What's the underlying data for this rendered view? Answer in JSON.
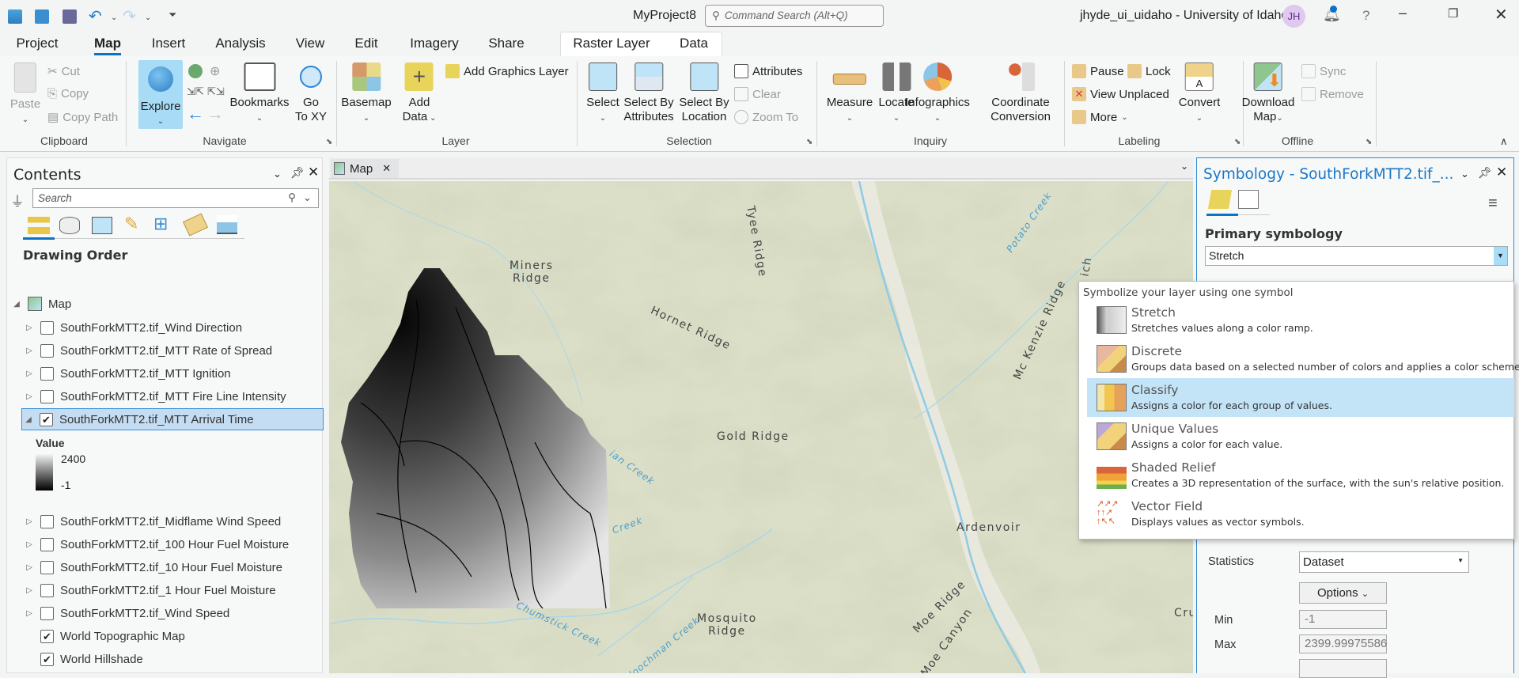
{
  "titlebar": {
    "project": "MyProject8",
    "search_placeholder": "Command Search (Alt+Q)",
    "user": "jhyde_ui_uidaho - University of Idaho",
    "avatar": "JH",
    "help": "?"
  },
  "tabs": [
    "Project",
    "Map",
    "Insert",
    "Analysis",
    "View",
    "Edit",
    "Imagery",
    "Share"
  ],
  "context_tabs": [
    "Raster Layer",
    "Data"
  ],
  "ribbon": {
    "clipboard": {
      "label": "Clipboard",
      "paste": "Paste",
      "cut": "Cut",
      "copy": "Copy",
      "copy_path": "Copy Path"
    },
    "navigate": {
      "label": "Navigate",
      "explore": "Explore",
      "bookmarks": "Bookmarks",
      "goto_1": "Go",
      "goto_2": "To XY"
    },
    "layer": {
      "label": "Layer",
      "basemap": "Basemap",
      "add_data_1": "Add",
      "add_data_2": "Data",
      "add_graphics": "Add Graphics Layer"
    },
    "selection": {
      "label": "Selection",
      "select": "Select",
      "by_attr_1": "Select By",
      "by_attr_2": "Attributes",
      "by_loc_1": "Select By",
      "by_loc_2": "Location",
      "attributes": "Attributes",
      "clear": "Clear",
      "zoom_to": "Zoom To"
    },
    "inquiry": {
      "label": "Inquiry",
      "measure": "Measure",
      "locate": "Locate",
      "infographics": "Infographics",
      "coord_1": "Coordinate",
      "coord_2": "Conversion"
    },
    "labeling": {
      "label": "Labeling",
      "pause": "Pause",
      "lock": "Lock",
      "view_unplaced": "View Unplaced",
      "more": "More",
      "convert": "Convert"
    },
    "offline": {
      "label": "Offline",
      "download_1": "Download",
      "download_2": "Map",
      "sync": "Sync",
      "remove": "Remove"
    }
  },
  "contents": {
    "title": "Contents",
    "search_placeholder": "Search",
    "section": "Drawing Order",
    "map": "Map",
    "layers": [
      {
        "name": "SouthForkMTT2.tif_Wind Direction",
        "checked": false
      },
      {
        "name": "SouthForkMTT2.tif_MTT Rate of Spread",
        "checked": false
      },
      {
        "name": "SouthForkMTT2.tif_MTT Ignition",
        "checked": false
      },
      {
        "name": "SouthForkMTT2.tif_MTT Fire Line Intensity",
        "checked": false
      },
      {
        "name": "SouthForkMTT2.tif_MTT Arrival Time",
        "checked": true,
        "selected": true
      },
      {
        "name": "SouthForkMTT2.tif_Midflame Wind Speed",
        "checked": false
      },
      {
        "name": "SouthForkMTT2.tif_100 Hour Fuel Moisture",
        "checked": false
      },
      {
        "name": "SouthForkMTT2.tif_10 Hour Fuel Moisture",
        "checked": false
      },
      {
        "name": "SouthForkMTT2.tif_1 Hour Fuel Moisture",
        "checked": false
      },
      {
        "name": "SouthForkMTT2.tif_Wind Speed",
        "checked": false
      },
      {
        "name": "World Topographic Map",
        "checked": true
      },
      {
        "name": "World Hillshade",
        "checked": true
      }
    ],
    "legend": {
      "title": "Value",
      "max": "2400",
      "min": "-1"
    }
  },
  "map": {
    "tab": "Map",
    "labels": {
      "miners_1": "Miners",
      "miners_2": "Ridge",
      "tyee": "Tyee Ridge",
      "hornet": "Hornet Ridge",
      "gold": "Gold Ridge",
      "ardenvoir": "Ardenvoir",
      "mosquito_1": "Mosquito",
      "mosquito_2": "Ridge",
      "moe_ridge": "Moe Ridge",
      "moe_canyon": "Moe Canyon",
      "chumstick": "Chumstick Creek",
      "potato": "Potato Creek",
      "mckenzie": "Mc Kenzie Ridge",
      "cru": "Cru",
      "ian_creek": "ian Creek",
      "creek": "Creek",
      "kloochman": "Kloochman Creek",
      "ich": "ich"
    }
  },
  "symbology": {
    "title": "Symbology - SouthForkMTT2.tif_...",
    "primary_label": "Primary symbology",
    "primary_value": "Stretch",
    "dropdown_header": "Symbolize your layer using one symbol",
    "options": [
      {
        "title": "Stretch",
        "desc": "Stretches values along a color ramp."
      },
      {
        "title": "Discrete",
        "desc": "Groups data based on a selected number of colors and applies a color scheme."
      },
      {
        "title": "Classify",
        "desc": "Assigns a color for each group of values.",
        "highlighted": true
      },
      {
        "title": "Unique Values",
        "desc": "Assigns a color for each value."
      },
      {
        "title": "Shaded Relief",
        "desc": "Creates a 3D representation of the surface, with the sun's relative position."
      },
      {
        "title": "Vector Field",
        "desc": "Displays values as vector symbols."
      }
    ],
    "statistics_label": "Statistics",
    "statistics_value": "Dataset",
    "options_button": "Options",
    "min_label": "Min",
    "min_value": "-1",
    "max_label": "Max",
    "max_value": "2399.99975586"
  },
  "colors": {
    "accent": "#0b72c6",
    "selection": "#c5ddf2",
    "dropdown_highlight": "#c3e3f7",
    "map_land": "#d8dcc1",
    "water": "#8fcbe6"
  }
}
